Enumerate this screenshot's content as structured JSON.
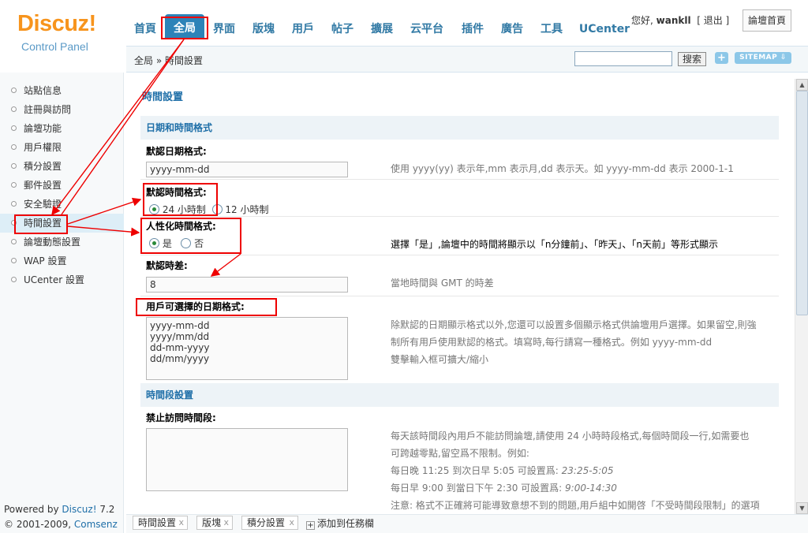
{
  "logo": {
    "brand": "Discuz!",
    "sub": "Control Panel"
  },
  "nav": {
    "tabs": [
      "首頁",
      "全局",
      "界面",
      "版塊",
      "用戶",
      "帖子",
      "擴展",
      "云平台",
      "插件",
      "廣告",
      "工具",
      "UCenter"
    ],
    "active_index": 1
  },
  "user": {
    "greeting": "您好,",
    "name": "wankll",
    "logout": "[ 退出 ]",
    "home_button": "論壇首頁"
  },
  "breadcrumb": "全局 » 時間設置",
  "search": {
    "button": "搜索",
    "placeholder": "",
    "plus": "+",
    "sitemap": "SITEMAP ⇩"
  },
  "sidebar": {
    "items": [
      "站點信息",
      "註冊與訪問",
      "論壇功能",
      "用戶權限",
      "積分設置",
      "郵件設置",
      "安全驗證",
      "時間設置",
      "論壇動態設置",
      "WAP 設置",
      "UCenter 設置"
    ],
    "active_index": 7
  },
  "footer": {
    "powered": "Powered by ",
    "powered_link": "Discuz!",
    "version": " 7.2",
    "copyright": "© 2001-2009, ",
    "company": "Comsenz Inc."
  },
  "main": {
    "title": "時間設置",
    "section1": "日期和時間格式",
    "date_format_label": "默認日期格式:",
    "date_format_value": "yyyy-mm-dd",
    "date_format_desc": "使用 yyyy(yy) 表示年,mm 表示月,dd 表示天。如 yyyy-mm-dd 表示 2000-1-1",
    "time_format_label": "默認時間格式:",
    "time_format_opt1": "24 小時制",
    "time_format_opt2": "12 小時制",
    "humanize_label": "人性化時間格式:",
    "humanize_yes": "是",
    "humanize_no": "否",
    "humanize_desc": "選擇「是」,論壇中的時間將顯示以「n分鐘前」、「昨天」、「n天前」等形式顯示",
    "timezone_label": "默認時差:",
    "timezone_value": "8",
    "timezone_desc": "當地時間與 GMT 的時差",
    "user_formats_label": "用戶可選擇的日期格式:",
    "user_formats_values": [
      "yyyy-mm-dd",
      "yyyy/mm/dd",
      "dd-mm-yyyy",
      "dd/mm/yyyy"
    ],
    "user_formats_desc": [
      "除默認的日期顯示格式以外,您還可以設置多個顯示格式供論壇用戶選擇。如果留空,則強",
      "制所有用戶使用默認的格式。填寫時,每行請寫一種格式。例如 yyyy-mm-dd",
      "雙擊輸入框可擴大/縮小"
    ],
    "section2": "時間段設置",
    "ban_label": "禁止訪問時間段:",
    "ban_desc": [
      "每天該時間段內用戶不能訪問論壇,請使用 24 小時時段格式,每個時間段一行,如需要也",
      "可跨越零點,留空爲不限制。例如:"
    ],
    "ban_ex1_text": "每日晚 11:25 到次日早 5:05 可設置爲: ",
    "ban_ex1_val": "23:25-5:05",
    "ban_ex2_text": "每日早 9:00 到當日下午 2:30 可設置爲: ",
    "ban_ex2_val": "9:00-14:30",
    "ban_note": "注意: 格式不正確將可能導致意想不到的問題,用戶組中如開啓「不受時間段限制」的選項"
  },
  "taskbar": {
    "tasks": [
      "時間設置",
      "版塊",
      "積分設置"
    ],
    "close": "x",
    "add": "添加到任務欄"
  }
}
